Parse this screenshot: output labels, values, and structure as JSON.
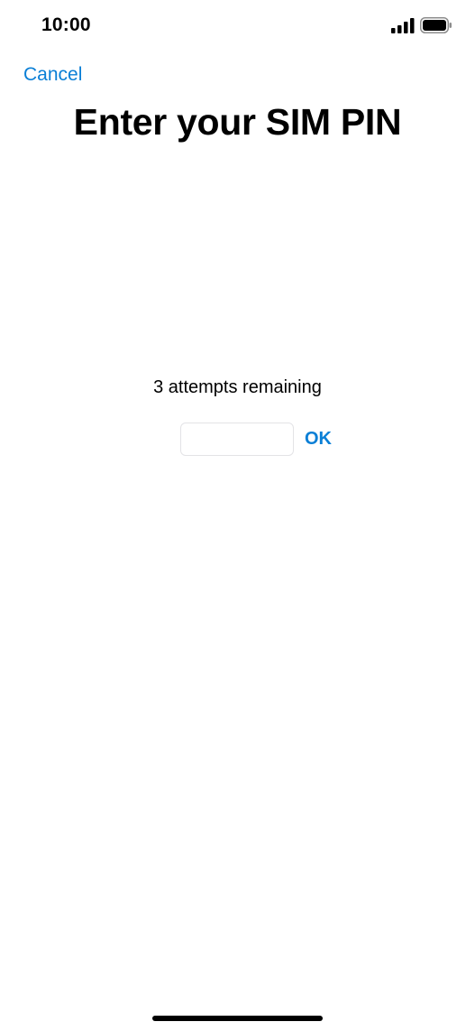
{
  "status_bar": {
    "time": "10:00",
    "signal_icon": "cellular-signal-icon",
    "battery_icon": "battery-full-icon"
  },
  "nav": {
    "cancel_label": "Cancel"
  },
  "title": "Enter your SIM PIN",
  "pin": {
    "attempts_text": "3 attempts remaining",
    "input_value": "",
    "ok_label": "OK"
  },
  "colors": {
    "accent": "#0a7fd6",
    "text": "#000000",
    "background": "#ffffff"
  }
}
